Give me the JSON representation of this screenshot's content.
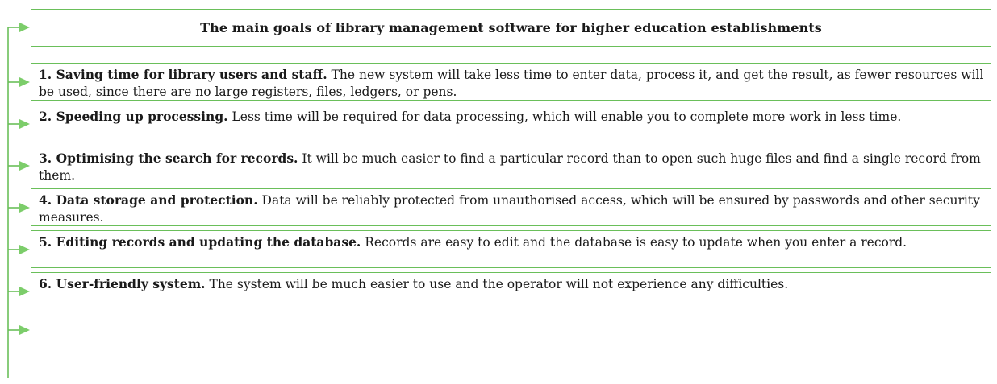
{
  "title": "The main goals of library management software for higher education establishments",
  "items": [
    {
      "heading": "1. Saving time for library users and staff.",
      "text": "The new system will take less time to enter data, process it, and get the result, as fewer resources will be used, since there are no large registers, files, ledgers, or pens."
    },
    {
      "heading": "2. Speeding up processing.",
      "text": "Less time will be required for data processing, which will enable you to complete more work in less time."
    },
    {
      "heading": "3. Optimising the search for records.",
      "text": "It will be much easier to find a particular record than to open such huge files and find a single record from them."
    },
    {
      "heading": "4. Data storage and protection.",
      "text": "Data will be reliably protected from unauthorised access, which will be ensured by passwords and other security measures."
    },
    {
      "heading": "5. Editing records and updating the database.",
      "text": "Records are easy to edit and the database is easy to update when you enter a record."
    },
    {
      "heading": "6. User-friendly system.",
      "text": "The system will be much easier to use and the operator will not experience any difficulties."
    }
  ],
  "colors": {
    "border": "#6abf5a",
    "connector": "#6abf5a",
    "arrow": "#7ccd6a"
  }
}
